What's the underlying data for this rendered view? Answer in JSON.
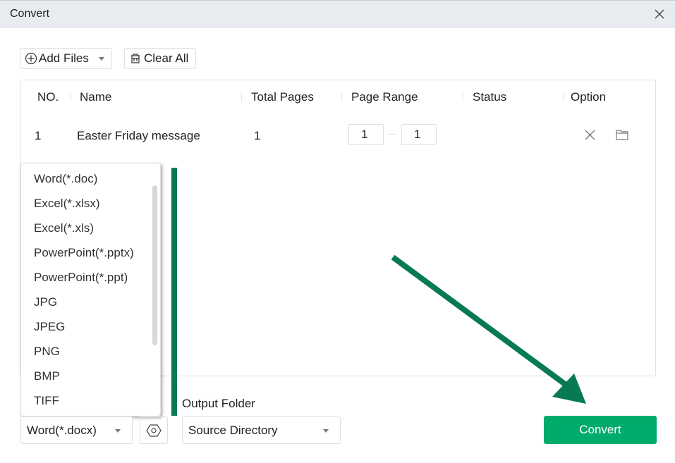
{
  "window": {
    "title": "Convert"
  },
  "toolbar": {
    "add_files_label": "Add Files",
    "clear_all_label": "Clear All"
  },
  "table": {
    "headers": {
      "no": "NO.",
      "name": "Name",
      "total_pages": "Total Pages",
      "page_range": "Page Range",
      "status": "Status",
      "option": "Option"
    },
    "rows": [
      {
        "no": "1",
        "name": "Easter Friday message",
        "total_pages": "1",
        "range_from": "1",
        "range_to": "1",
        "status": ""
      }
    ]
  },
  "format_dropdown": {
    "options": [
      "Word(*.doc)",
      "Excel(*.xlsx)",
      "Excel(*.xls)",
      "PowerPoint(*.pptx)",
      "PowerPoint(*.ppt)",
      "JPG",
      "JPEG",
      "PNG",
      "BMP",
      "TIFF"
    ],
    "selected": "Word(*.docx)"
  },
  "output": {
    "label": "Output Folder",
    "selected": "Source Directory"
  },
  "actions": {
    "convert_label": "Convert"
  },
  "colors": {
    "accent": "#00ab6b",
    "annotation": "#077a55"
  }
}
